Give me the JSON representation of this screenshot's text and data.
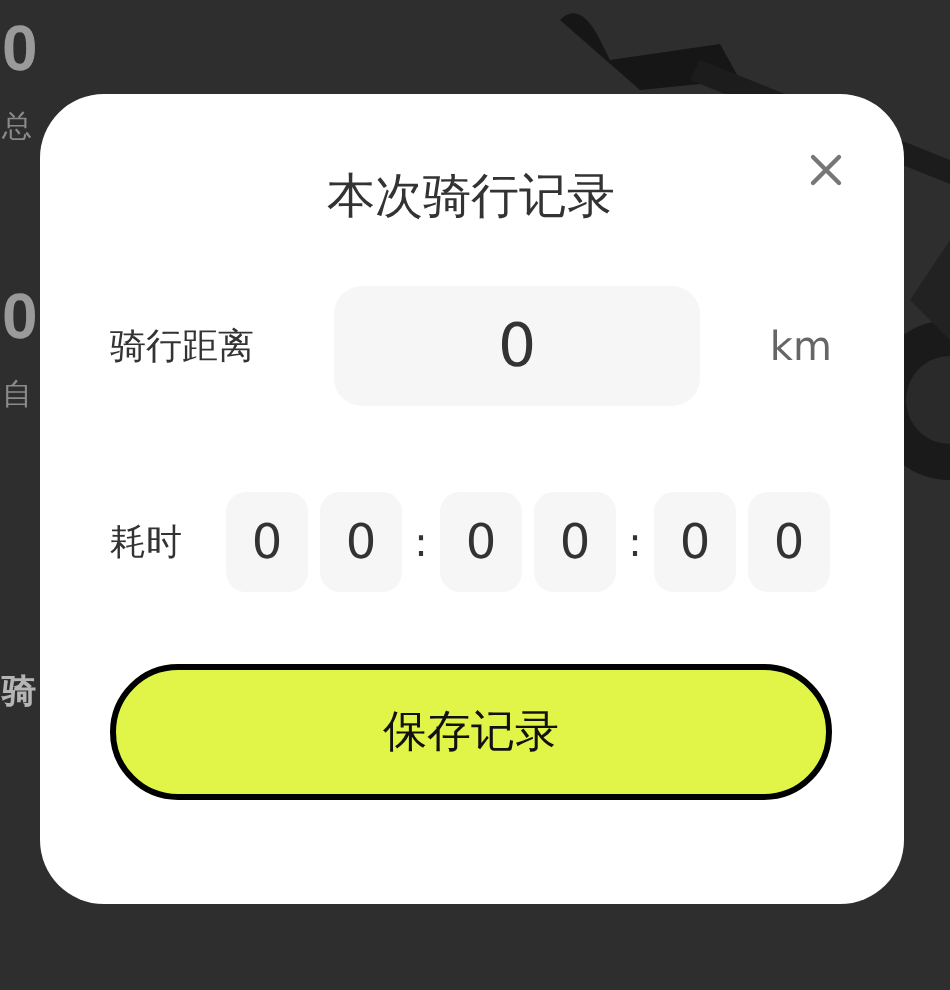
{
  "background": {
    "stats": [
      {
        "value": "0",
        "label": "总"
      },
      {
        "value": "0",
        "label": "自"
      }
    ],
    "section_title": "骑"
  },
  "dialog": {
    "title": "本次骑行记录",
    "distance": {
      "label": "骑行距离",
      "value": "0",
      "unit": "km"
    },
    "duration": {
      "label": "耗时",
      "parts": [
        {
          "kind": "digit",
          "text": "0"
        },
        {
          "kind": "digit",
          "text": "0"
        },
        {
          "kind": "separator",
          "text": ":"
        },
        {
          "kind": "digit",
          "text": "0"
        },
        {
          "kind": "digit",
          "text": "0"
        },
        {
          "kind": "separator",
          "text": ":"
        },
        {
          "kind": "digit",
          "text": "0"
        },
        {
          "kind": "digit",
          "text": "0"
        }
      ]
    },
    "button": "保存记录"
  }
}
